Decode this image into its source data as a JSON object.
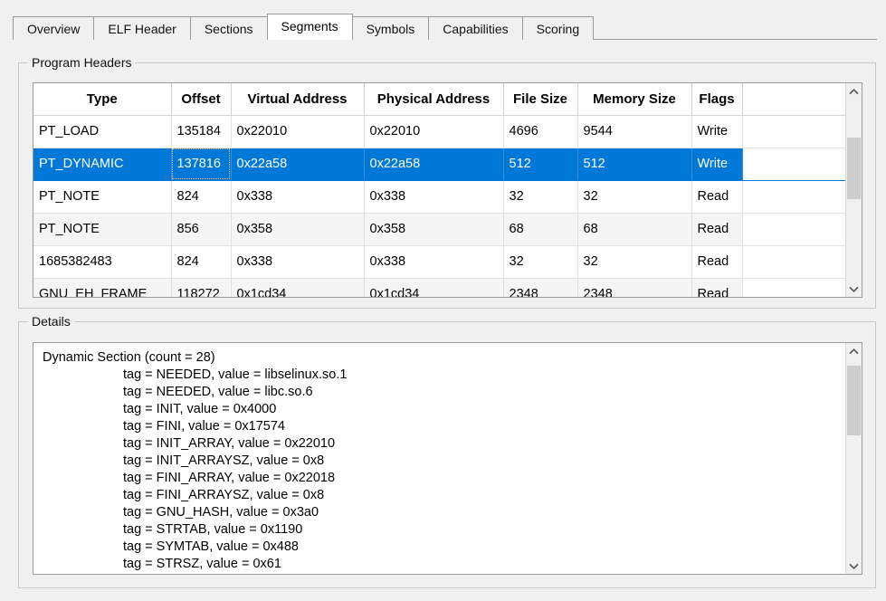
{
  "tabs": [
    {
      "label": "Overview",
      "selected": false
    },
    {
      "label": "ELF Header",
      "selected": false
    },
    {
      "label": "Sections",
      "selected": false
    },
    {
      "label": "Segments",
      "selected": true
    },
    {
      "label": "Symbols",
      "selected": false
    },
    {
      "label": "Capabilities",
      "selected": false
    },
    {
      "label": "Scoring",
      "selected": false
    }
  ],
  "colors": {
    "selection": "#0078d7",
    "window_bg": "#f0f0f0",
    "focus_outline": "#ffb357",
    "scroll_thumb": "#cdcdcd"
  },
  "program_headers": {
    "group_title": "Program Headers",
    "columns": [
      "Type",
      "Offset",
      "Virtual Address",
      "Physical Address",
      "File Size",
      "Memory Size",
      "Flags"
    ],
    "rows": [
      {
        "type": "PT_LOAD",
        "offset": "135184",
        "vaddr": "0x22010",
        "paddr": "0x22010",
        "file_size": "4696",
        "mem_size": "9544",
        "flags": "Write",
        "selected": false
      },
      {
        "type": "PT_DYNAMIC",
        "offset": "137816",
        "vaddr": "0x22a58",
        "paddr": "0x22a58",
        "file_size": "512",
        "mem_size": "512",
        "flags": "Write",
        "selected": true
      },
      {
        "type": "PT_NOTE",
        "offset": "824",
        "vaddr": "0x338",
        "paddr": "0x338",
        "file_size": "32",
        "mem_size": "32",
        "flags": "Read",
        "selected": false
      },
      {
        "type": "PT_NOTE",
        "offset": "856",
        "vaddr": "0x358",
        "paddr": "0x358",
        "file_size": "68",
        "mem_size": "68",
        "flags": "Read",
        "selected": false
      },
      {
        "type": "1685382483",
        "offset": "824",
        "vaddr": "0x338",
        "paddr": "0x338",
        "file_size": "32",
        "mem_size": "32",
        "flags": "Read",
        "selected": false
      },
      {
        "type": "GNU_EH_FRAME",
        "offset": "118272",
        "vaddr": "0x1cd34",
        "paddr": "0x1cd34",
        "file_size": "2348",
        "mem_size": "2348",
        "flags": "Read",
        "selected": false
      }
    ],
    "scrollbar": {
      "up_icon": "chevron-up-icon",
      "down_icon": "chevron-down-icon"
    }
  },
  "details": {
    "group_title": "Details",
    "header_line": "Dynamic Section (count = 28)",
    "entries": [
      "tag = NEEDED, value = libselinux.so.1",
      "tag = NEEDED, value = libc.so.6",
      "tag = INIT, value = 0x4000",
      "tag = FINI, value = 0x17574",
      "tag = INIT_ARRAY, value = 0x22010",
      "tag = INIT_ARRAYSZ, value = 0x8",
      "tag = FINI_ARRAY, value = 0x22018",
      "tag = FINI_ARRAYSZ, value = 0x8",
      "tag = GNU_HASH, value = 0x3a0",
      "tag = STRTAB, value = 0x1190",
      "tag = SYMTAB, value = 0x488",
      "tag = STRSZ, value = 0x61"
    ],
    "scrollbar": {
      "up_icon": "chevron-up-icon",
      "down_icon": "chevron-down-icon"
    }
  }
}
